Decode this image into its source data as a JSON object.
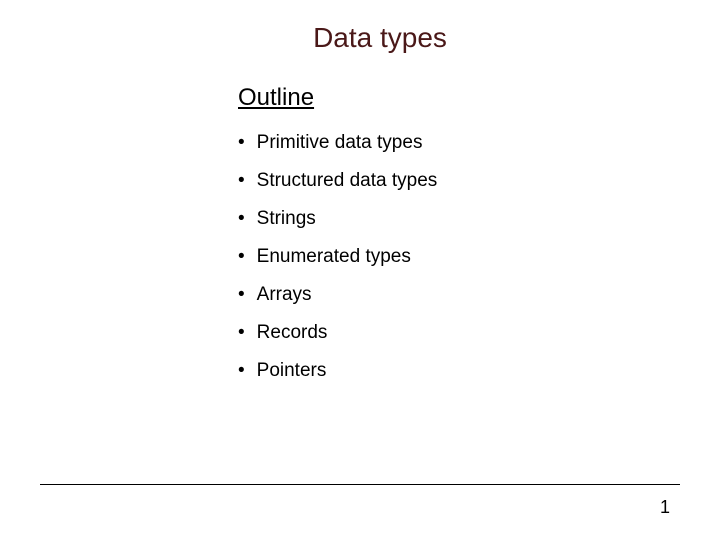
{
  "title": "Data types",
  "subheading": "Outline",
  "bullets": {
    "b0": "Primitive data types",
    "b1": "Structured data types",
    "b2": "Strings",
    "b3": "Enumerated types",
    "b4": "Arrays",
    "b5": "Records",
    "b6": "Pointers"
  },
  "page_number": "1"
}
